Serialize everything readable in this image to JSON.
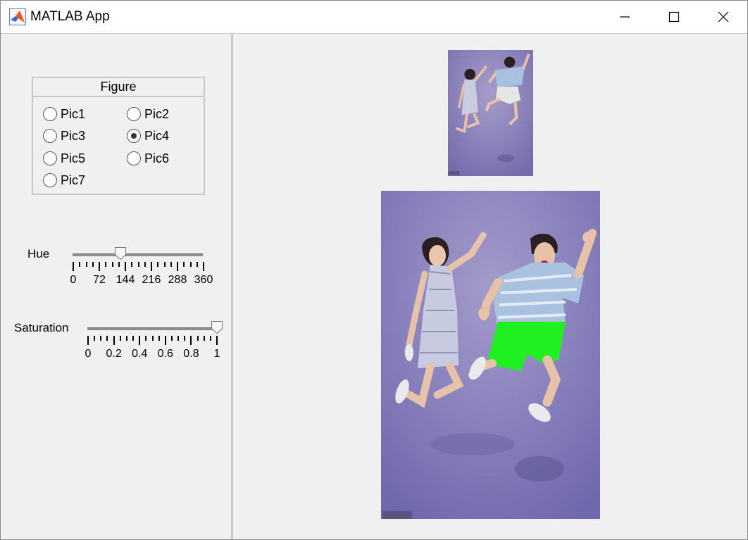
{
  "window": {
    "title": "MATLAB App",
    "controls": [
      "minimize",
      "maximize",
      "close"
    ]
  },
  "figure_group": {
    "title": "Figure",
    "options": [
      {
        "label": "Pic1",
        "selected": false
      },
      {
        "label": "Pic2",
        "selected": false
      },
      {
        "label": "Pic3",
        "selected": false
      },
      {
        "label": "Pic4",
        "selected": true
      },
      {
        "label": "Pic5",
        "selected": false
      },
      {
        "label": "Pic6",
        "selected": false
      },
      {
        "label": "Pic7",
        "selected": false
      }
    ]
  },
  "hue_slider": {
    "label": "Hue",
    "value": 130,
    "min": 0,
    "max": 360,
    "tick_labels": [
      "0",
      "72",
      "144",
      "216",
      "288",
      "360"
    ]
  },
  "saturation_slider": {
    "label": "Saturation",
    "value": 1,
    "min": 0,
    "max": 1,
    "tick_labels": [
      "0",
      "0.2",
      "0.4",
      "0.6",
      "0.8",
      "1"
    ]
  },
  "images": {
    "small": {
      "watermark": "视觉中国"
    },
    "large": {
      "watermark": "视觉中国"
    }
  },
  "colors": {
    "background": "#f0f0f0",
    "photo_backdrop": "#7d75b6",
    "recolored_shorts": "#1ff01f"
  }
}
